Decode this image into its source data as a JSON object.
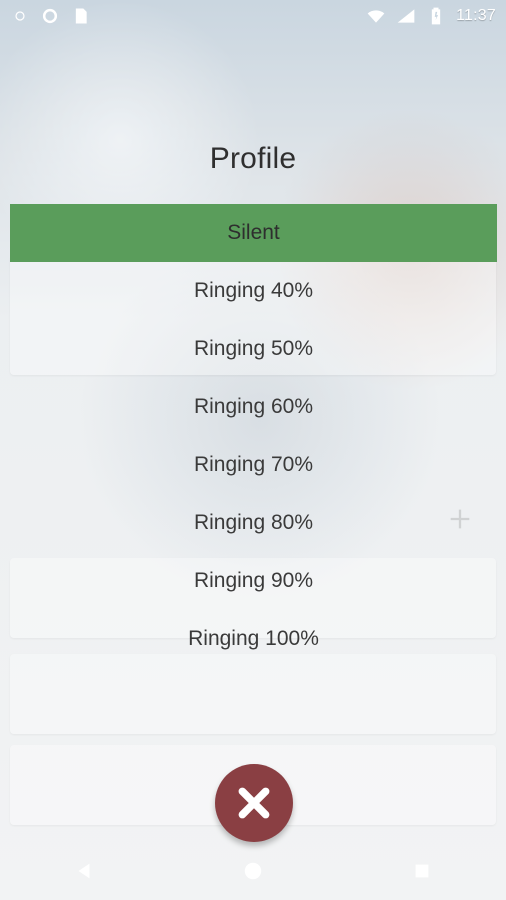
{
  "status_bar": {
    "time": "11:37",
    "icons": [
      "settings-icon",
      "circle-icon",
      "sd-card-icon",
      "wifi-icon",
      "signal-icon",
      "battery-icon"
    ]
  },
  "dialog": {
    "title": "Profile",
    "items": [
      {
        "label": "Silent",
        "selected": true
      },
      {
        "label": "Ringing 40%",
        "selected": false
      },
      {
        "label": "Ringing 50%",
        "selected": false
      },
      {
        "label": "Ringing 60%",
        "selected": false
      },
      {
        "label": "Ringing 70%",
        "selected": false
      },
      {
        "label": "Ringing 80%",
        "selected": false
      },
      {
        "label": "Ringing 90%",
        "selected": false
      },
      {
        "label": "Ringing 100%",
        "selected": false
      }
    ],
    "close_icon": "close-icon"
  },
  "nav_bar": {
    "buttons": [
      "back-icon",
      "home-icon",
      "recents-icon"
    ]
  },
  "colors": {
    "selected": "#5a9d5b",
    "close_button": "#8a3f43"
  }
}
